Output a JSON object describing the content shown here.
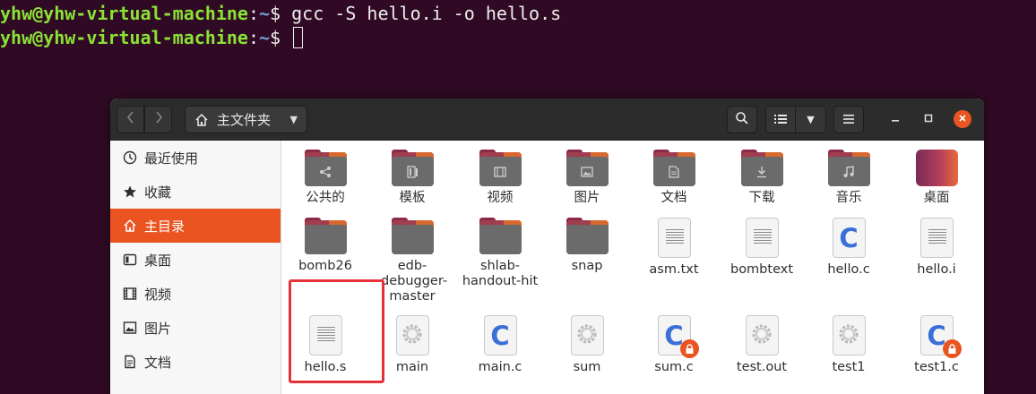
{
  "terminal": {
    "user_host": "yhw@yhw-virtual-machine",
    "colon": ":",
    "path": "~",
    "dollar": "$",
    "line1_command": " gcc -S hello.i -o hello.s",
    "line2_command": " "
  },
  "window": {
    "location_label": "主文件夹",
    "icons": {
      "back": "chevron-left-icon",
      "forward": "chevron-right-icon",
      "home": "home-icon",
      "search": "search-icon",
      "view": "list-view-icon",
      "menu": "hamburger-icon"
    }
  },
  "sidebar": {
    "items": [
      {
        "label": "最近使用",
        "icon": "clock-icon",
        "active": false
      },
      {
        "label": "收藏",
        "icon": "star-icon",
        "active": false
      },
      {
        "label": "主目录",
        "icon": "home-icon",
        "active": true
      },
      {
        "label": "桌面",
        "icon": "desktop-icon",
        "active": false
      },
      {
        "label": "视频",
        "icon": "film-icon",
        "active": false
      },
      {
        "label": "图片",
        "icon": "picture-icon",
        "active": false
      },
      {
        "label": "文档",
        "icon": "document-icon",
        "active": false
      }
    ]
  },
  "files": [
    {
      "name": "公共的",
      "type": "folder",
      "emblem": "share-icon"
    },
    {
      "name": "模板",
      "type": "folder",
      "emblem": "template-icon"
    },
    {
      "name": "视频",
      "type": "folder",
      "emblem": "film-icon"
    },
    {
      "name": "图片",
      "type": "folder",
      "emblem": "picture-icon"
    },
    {
      "name": "文档",
      "type": "folder",
      "emblem": "document-icon"
    },
    {
      "name": "下载",
      "type": "folder",
      "emblem": "download-icon"
    },
    {
      "name": "音乐",
      "type": "folder",
      "emblem": "music-icon"
    },
    {
      "name": "桌面",
      "type": "desktop-folder",
      "emblem": "desktop-icon"
    },
    {
      "name": "bomb26",
      "type": "folder"
    },
    {
      "name": "edb-debugger-master",
      "type": "folder"
    },
    {
      "name": "shlab-handout-hit",
      "type": "folder"
    },
    {
      "name": "snap",
      "type": "folder"
    },
    {
      "name": "asm.txt",
      "type": "text"
    },
    {
      "name": "bombtext",
      "type": "text"
    },
    {
      "name": "hello.c",
      "type": "c-source"
    },
    {
      "name": "hello.i",
      "type": "text"
    },
    {
      "name": "hello.s",
      "type": "text",
      "highlighted": true
    },
    {
      "name": "main",
      "type": "executable"
    },
    {
      "name": "main.c",
      "type": "c-source"
    },
    {
      "name": "sum",
      "type": "executable"
    },
    {
      "name": "sum.c",
      "type": "c-source",
      "locked": true
    },
    {
      "name": "test.out",
      "type": "executable"
    },
    {
      "name": "test1",
      "type": "executable"
    },
    {
      "name": "test1.c",
      "type": "c-source",
      "locked": true
    }
  ],
  "colors": {
    "accent": "#e95420",
    "terminal_bg": "#300a24",
    "highlight_box": "#e53238"
  }
}
